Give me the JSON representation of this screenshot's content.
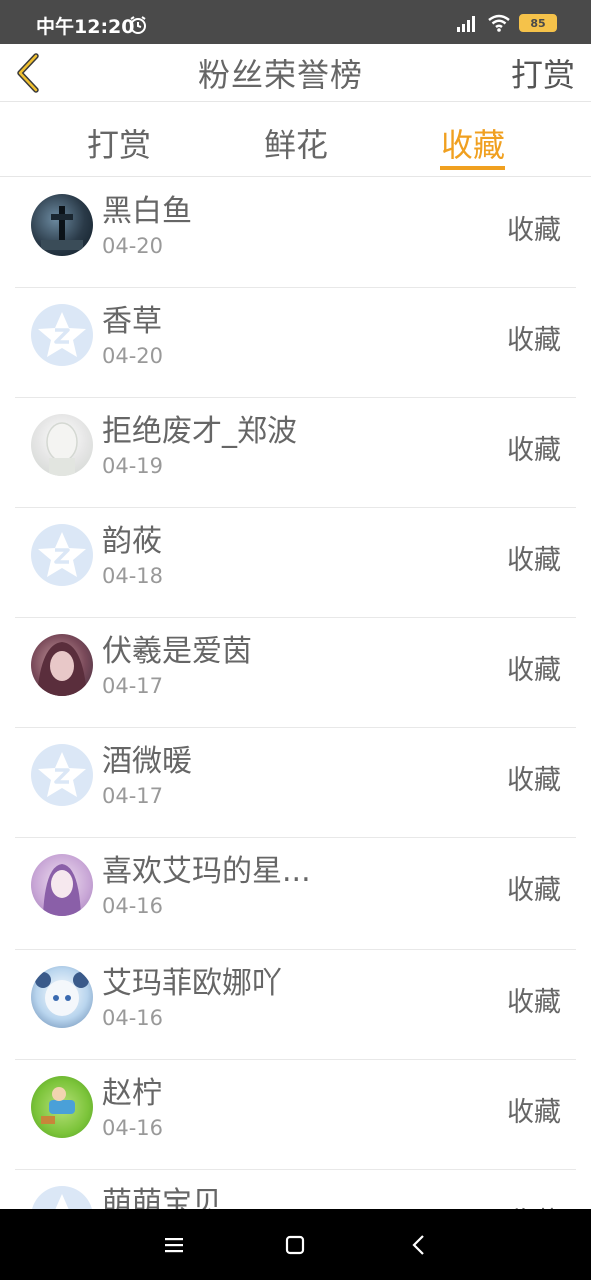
{
  "status_bar": {
    "time": "中午12:20",
    "battery": "85",
    "icons": [
      "alarm-icon",
      "signal-icon",
      "wifi-icon",
      "battery-icon"
    ]
  },
  "header": {
    "title": "粉丝荣誉榜",
    "action": "打赏",
    "back_icon": "chevron-left-icon"
  },
  "tabs": [
    {
      "label": "打赏",
      "active": false
    },
    {
      "label": "鲜花",
      "active": false
    },
    {
      "label": "收藏",
      "active": true
    }
  ],
  "colors": {
    "accent": "#f0a020",
    "status_bar_bg": "#4a4a4a",
    "nav_bar_bg": "#000000"
  },
  "rows": [
    {
      "name": "黑白鱼",
      "date": "04-20",
      "action": "收藏"
    },
    {
      "name": "香草",
      "date": "04-20",
      "action": "收藏"
    },
    {
      "name": "拒绝废才_郑波",
      "date": "04-19",
      "action": "收藏"
    },
    {
      "name": "韵莜",
      "date": "04-18",
      "action": "收藏"
    },
    {
      "name": "伏羲是爱茵",
      "date": "04-17",
      "action": "收藏"
    },
    {
      "name": "酒微暖",
      "date": "04-17",
      "action": "收藏"
    },
    {
      "name": "喜欢艾玛的星...",
      "date": "04-16",
      "action": "收藏"
    },
    {
      "name": "艾玛菲欧娜吖",
      "date": "04-16",
      "action": "收藏"
    },
    {
      "name": "赵柠",
      "date": "04-16",
      "action": "收藏"
    },
    {
      "name": "萌萌宝贝",
      "date": "",
      "action": "收藏"
    }
  ],
  "nav_bar": {
    "icons": [
      "menu-icon",
      "home-icon",
      "back-icon"
    ]
  }
}
